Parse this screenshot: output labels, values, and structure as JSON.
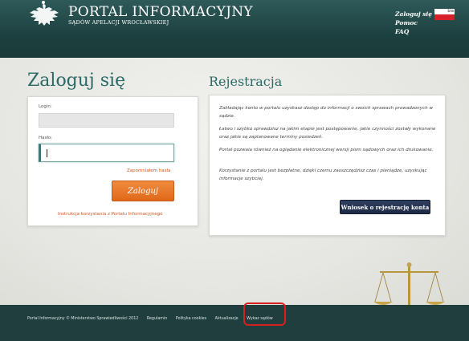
{
  "header": {
    "title": "PORTAL INFORMACYJNY",
    "subtitle": "SĄDÓW APELACJI WROCŁAWSKIEJ",
    "nav": [
      "Zaloguj się",
      "Pomoc",
      "FAQ"
    ],
    "language": "bia",
    "emblem_icon": "eagle-emblem-icon",
    "flag_icon": "poland-flag-icon"
  },
  "login": {
    "heading": "Zaloguj się",
    "login_label": "Login:",
    "login_value": "",
    "password_label": "Hasło:",
    "password_value": "",
    "forgot_link": "Zapomniałem hasła",
    "submit_label": "Zaloguj",
    "instructions_link": "Instrukcja korzystania z Portalu Informacyjnego"
  },
  "registration": {
    "heading": "Rejestracja",
    "paragraphs": [
      "Zakładając konto w portalu uzyskasz dostęp do informacji o swoich sprawach prowadzonych w sądzie.",
      "Łatwo i szybko sprawdzisz na jakim etapie jest postępowanie, jakie czynności zostały wykonane oraz jakie są zaplanowane terminy posiedzeń.",
      "Portal pozwala również na oglądanie elektronicznej wersji pism sądowych oraz ich drukowanie.",
      "Korzystanie z portalu jest bezpłatne, dzięki czemu zaoszczędzisz czas i pieniądze, uzyskując informacje szybciej."
    ],
    "button_label": "Wniosek o rejestrację konta"
  },
  "footer": {
    "copyright": "Portal Informacyjny © Ministerstwo Sprawiedliwości 2012",
    "links": [
      "Regulamin",
      "Polityka cookies",
      "Aktualizacje",
      "Wykaz sądów"
    ],
    "highlighted_link": "Wykaz sądów"
  },
  "decoration": {
    "scales_icon": "justice-scales-icon"
  },
  "colors": {
    "header_bg": "#1d4140",
    "accent_teal": "#2a6a66",
    "login_button": "#e0681a",
    "register_button": "#1d2a45",
    "highlight_red": "#d62020"
  }
}
